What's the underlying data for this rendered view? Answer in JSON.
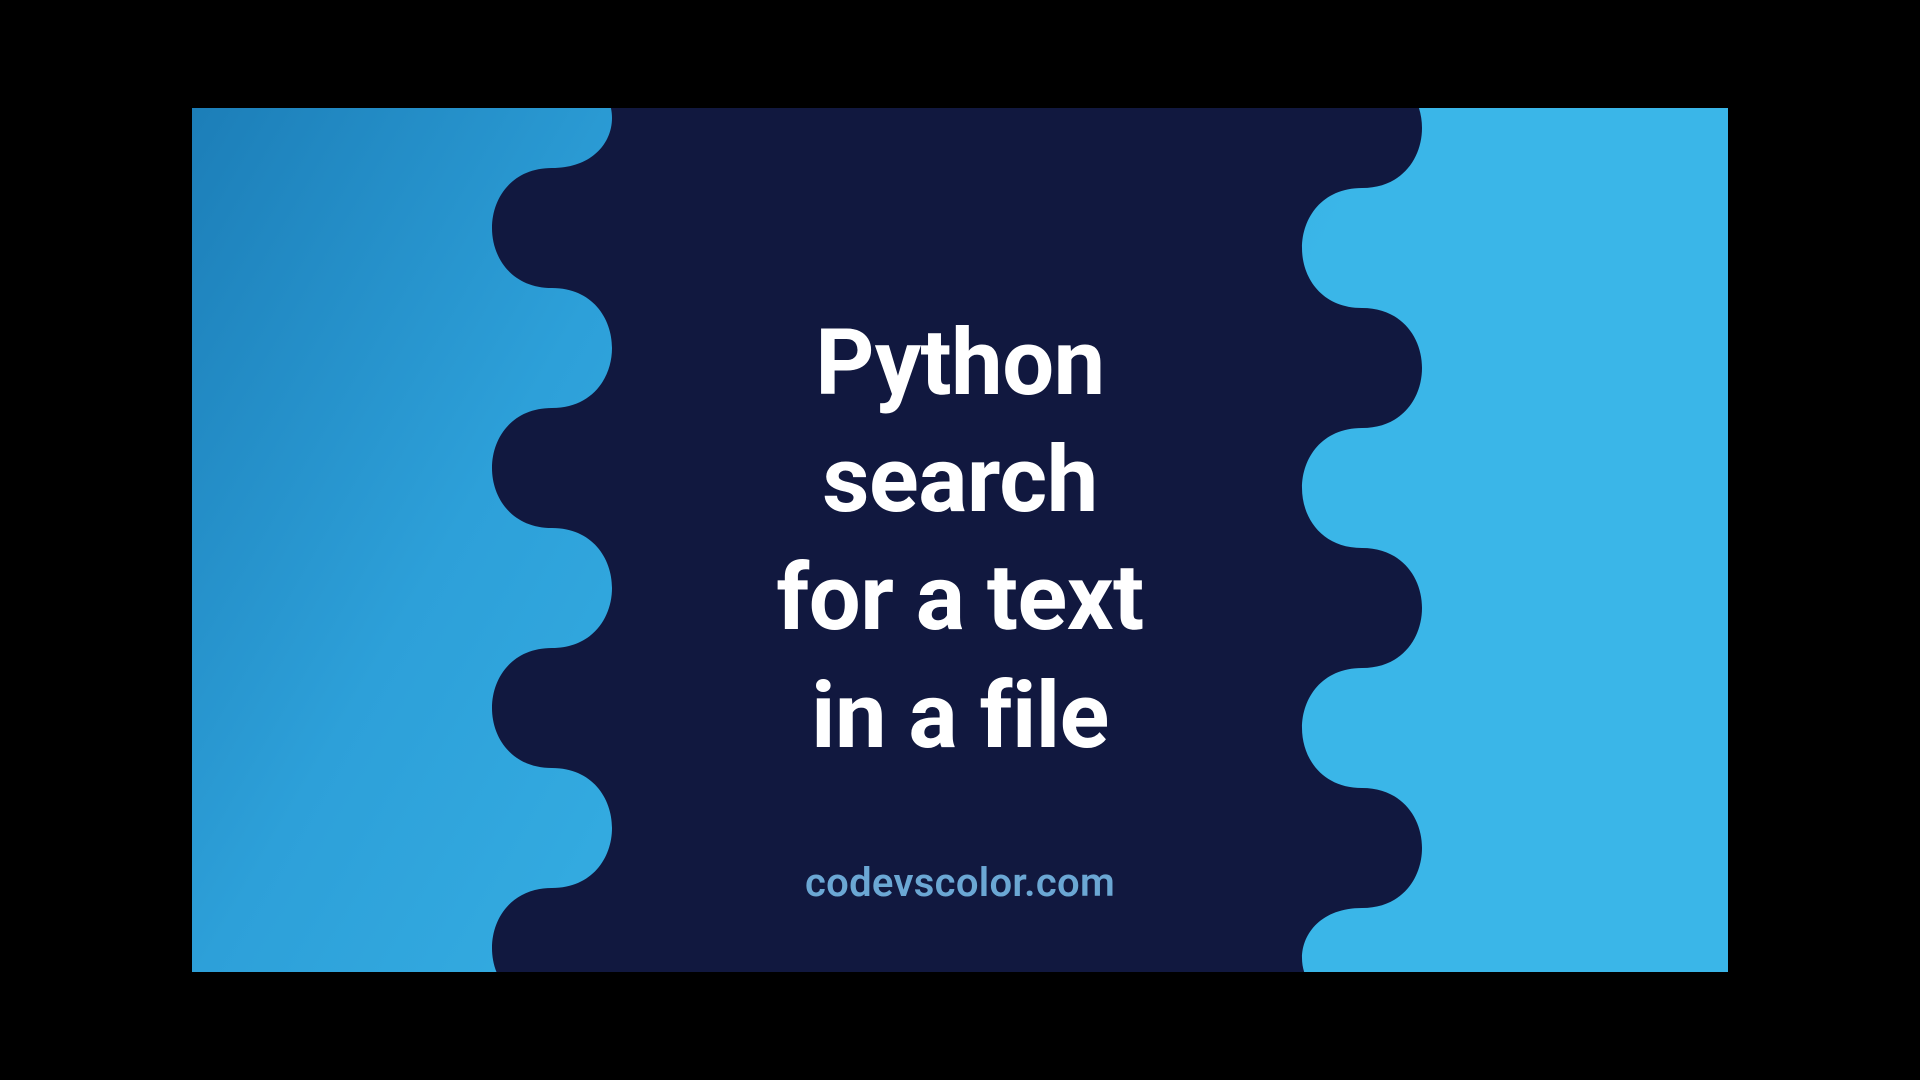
{
  "title_lines": [
    "Python",
    "search",
    "for a text",
    "in a file"
  ],
  "brand": "codevscolor.com",
  "colors": {
    "bg_gradient_from": "#1c7eb8",
    "bg_gradient_to": "#3ab6e8",
    "shape": "#11183f",
    "title": "#ffffff",
    "brand": "#6ba7d4"
  }
}
